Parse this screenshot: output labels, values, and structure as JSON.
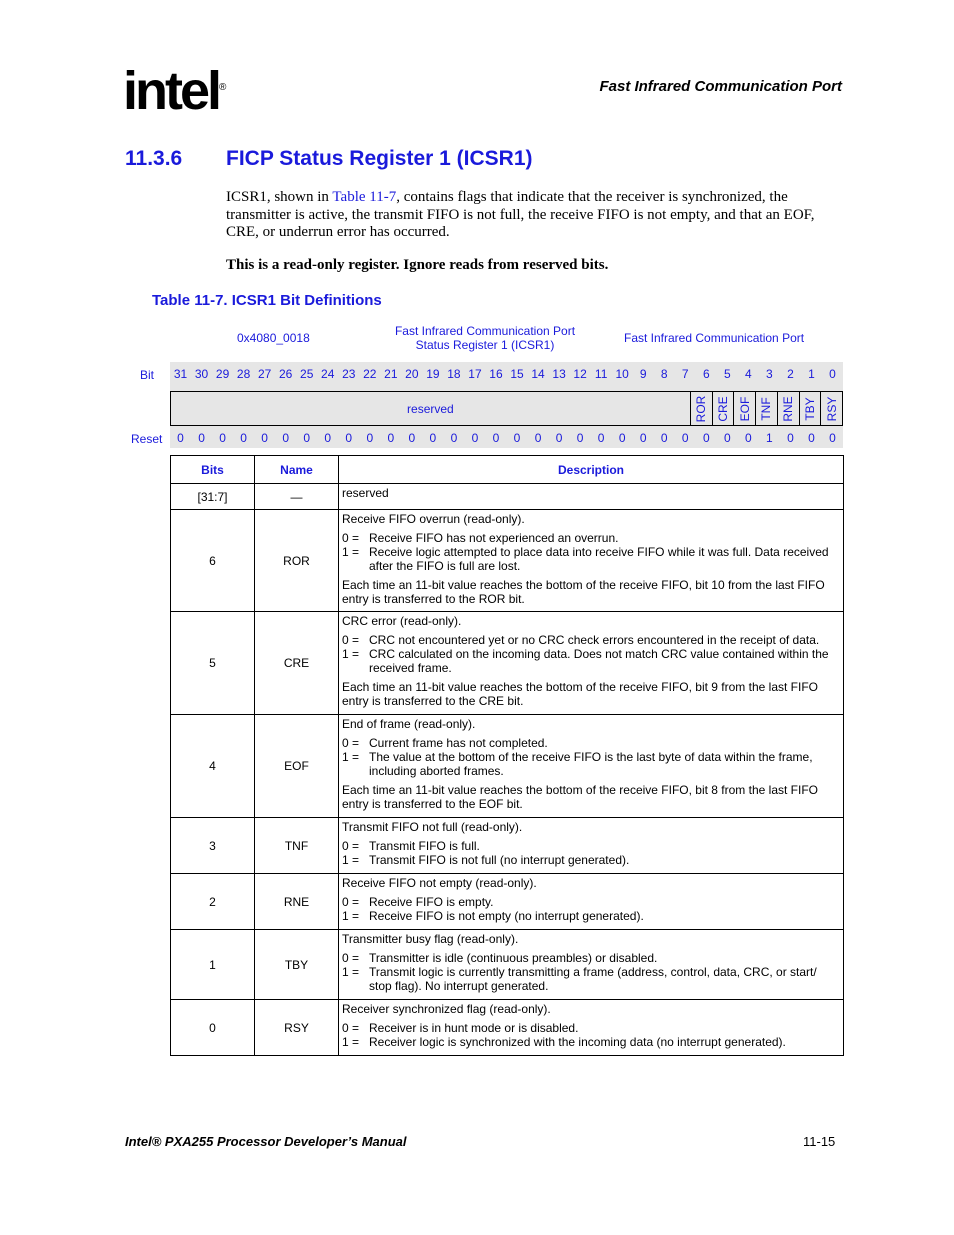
{
  "header": {
    "logo": "intel",
    "running_title": "Fast Infrared Communication Port"
  },
  "section": {
    "number": "11.3.6",
    "title": "FICP Status Register 1 (ICSR1)"
  },
  "body": {
    "p1_a": "ICSR1, shown in ",
    "p1_link": "Table 11-7",
    "p1_b": ", contains flags that indicate that the receiver is synchronized, the transmitter is active, the transmit FIFO is not full, the receive FIFO is not empty, and that an EOF, CRE, or underrun error has occurred.",
    "note": "This is a read-only register. Ignore reads from reserved bits."
  },
  "table_caption": "Table 11-7. ICSR1 Bit Definitions",
  "register": {
    "address": "0x4080_0018",
    "name_line1": "Fast Infrared Communication Port",
    "name_line2": "Status Register 1 (ICSR1)",
    "unit": "Fast Infrared Communication Port",
    "bit_label": "Bit",
    "reset_label": "Reset",
    "bits": [
      "31",
      "30",
      "29",
      "28",
      "27",
      "26",
      "25",
      "24",
      "23",
      "22",
      "21",
      "20",
      "19",
      "18",
      "17",
      "16",
      "15",
      "14",
      "13",
      "12",
      "11",
      "10",
      "9",
      "8",
      "7",
      "6",
      "5",
      "4",
      "3",
      "2",
      "1",
      "0"
    ],
    "reserved_label": "reserved",
    "fields": [
      "ROR",
      "CRE",
      "EOF",
      "TNF",
      "RNE",
      "TBY",
      "RSY"
    ],
    "reset": [
      "0",
      "0",
      "0",
      "0",
      "0",
      "0",
      "0",
      "0",
      "0",
      "0",
      "0",
      "0",
      "0",
      "0",
      "0",
      "0",
      "0",
      "0",
      "0",
      "0",
      "0",
      "0",
      "0",
      "0",
      "0",
      "0",
      "0",
      "0",
      "1",
      "0",
      "0",
      "0"
    ]
  },
  "bit_table": {
    "headers": [
      "Bits",
      "Name",
      "Description"
    ],
    "rows": [
      {
        "bits": "[31:7]",
        "name": "—",
        "desc": "reserved"
      },
      {
        "bits": "6",
        "name": "ROR",
        "title": "Receive FIFO overrun (read-only).",
        "items": [
          [
            "0 =",
            "Receive FIFO has not experienced an overrun."
          ],
          [
            "1 =",
            "Receive logic attempted to place data into receive FIFO while it was full. Data received after the FIFO is full are lost."
          ]
        ],
        "extra": "Each time an 11-bit value reaches the bottom of the receive FIFO, bit 10 from the last FIFO entry is transferred to the ROR bit."
      },
      {
        "bits": "5",
        "name": "CRE",
        "title": "CRC error (read-only).",
        "items": [
          [
            "0 =",
            "CRC not encountered yet or no CRC check errors encountered in the receipt of data."
          ],
          [
            "1 =",
            "CRC calculated on the incoming data. Does not match CRC value contained within the received frame."
          ]
        ],
        "extra": "Each time an 11-bit value reaches the bottom of the receive FIFO, bit 9 from the last FIFO entry is transferred to the CRE bit."
      },
      {
        "bits": "4",
        "name": "EOF",
        "title": "End of frame (read-only).",
        "items": [
          [
            "0 =",
            "Current frame has not completed."
          ],
          [
            "1 =",
            "The value at the bottom of the receive FIFO is the last byte of data within the frame, including aborted frames."
          ]
        ],
        "extra": "Each time an 11-bit value reaches the bottom of the receive FIFO, bit 8 from the last FIFO entry is transferred to the EOF bit."
      },
      {
        "bits": "3",
        "name": "TNF",
        "title": "Transmit FIFO not full (read-only).",
        "items": [
          [
            "0 =",
            "Transmit FIFO is full."
          ],
          [
            "1 =",
            "Transmit FIFO is not full (no interrupt generated)."
          ]
        ]
      },
      {
        "bits": "2",
        "name": "RNE",
        "title": "Receive FIFO not empty (read-only).",
        "items": [
          [
            "0 =",
            "Receive FIFO is empty."
          ],
          [
            "1 =",
            "Receive FIFO is not empty (no interrupt generated)."
          ]
        ]
      },
      {
        "bits": "1",
        "name": "TBY",
        "title": "Transmitter busy flag (read-only).",
        "items": [
          [
            "0 =",
            "Transmitter is idle (continuous preambles) or disabled."
          ],
          [
            "1 =",
            "Transmit logic is currently transmitting a frame (address, control, data, CRC, or start/ stop flag). No interrupt generated."
          ]
        ]
      },
      {
        "bits": "0",
        "name": "RSY",
        "title": "Receiver synchronized flag (read-only).",
        "items": [
          [
            "0 =",
            "Receiver is in hunt mode or is disabled."
          ],
          [
            "1 =",
            "Receiver logic is synchronized with the incoming data (no interrupt generated)."
          ]
        ]
      }
    ]
  },
  "footer": {
    "manual": "Intel® PXA255 Processor Developer’s Manual",
    "page": "11-15"
  }
}
